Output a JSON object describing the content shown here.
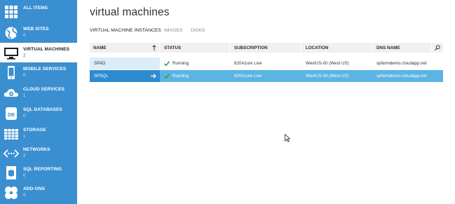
{
  "sidebar": {
    "items": [
      {
        "label": "ALL ITEMS",
        "count": "",
        "icon": "grid-icon"
      },
      {
        "label": "WEB SITES",
        "count": "0",
        "icon": "globe-icon"
      },
      {
        "label": "VIRTUAL MACHINES",
        "count": "2",
        "icon": "monitor-icon"
      },
      {
        "label": "MOBILE SERVICES",
        "count": "0",
        "icon": "phone-icon"
      },
      {
        "label": "CLOUD SERVICES",
        "count": "1",
        "icon": "gear-icon"
      },
      {
        "label": "SQL DATABASES",
        "count": "0",
        "icon": "database-icon"
      },
      {
        "label": "STORAGE",
        "count": "1",
        "icon": "storage-icon"
      },
      {
        "label": "NETWORKS",
        "count": "2",
        "icon": "network-icon"
      },
      {
        "label": "SQL REPORTING",
        "count": "0",
        "icon": "report-icon"
      },
      {
        "label": "ADD-ONS",
        "count": "0",
        "icon": "addons-icon"
      }
    ]
  },
  "main": {
    "title": "virtual machines",
    "tabs": [
      {
        "label": "VIRTUAL MACHINE INSTANCES",
        "active": true
      },
      {
        "label": "IMAGES",
        "active": false
      },
      {
        "label": "DISKS",
        "active": false
      }
    ],
    "columns": [
      "NAME",
      "STATUS",
      "SUBSCRIPTION",
      "LOCATION",
      "DNS NAME"
    ],
    "rows": [
      {
        "name": "SPAD",
        "status": "Running",
        "subscription": "820Azure Live",
        "location": "WestUS-00 (West US)",
        "dns": "spfarmdemo.cloudapp.net"
      },
      {
        "name": "SPSQL",
        "status": "Running",
        "subscription": "820Azure Live",
        "location": "WestUS-00 (West US)",
        "dns": "spfarmdemo.cloudapp.net"
      }
    ]
  },
  "colors": {
    "sidebar": "#3a8fd1",
    "selected_row": "#5ab4e4",
    "selected_name_cell": "#2d8cd0",
    "status_check": "#3aa12a"
  }
}
